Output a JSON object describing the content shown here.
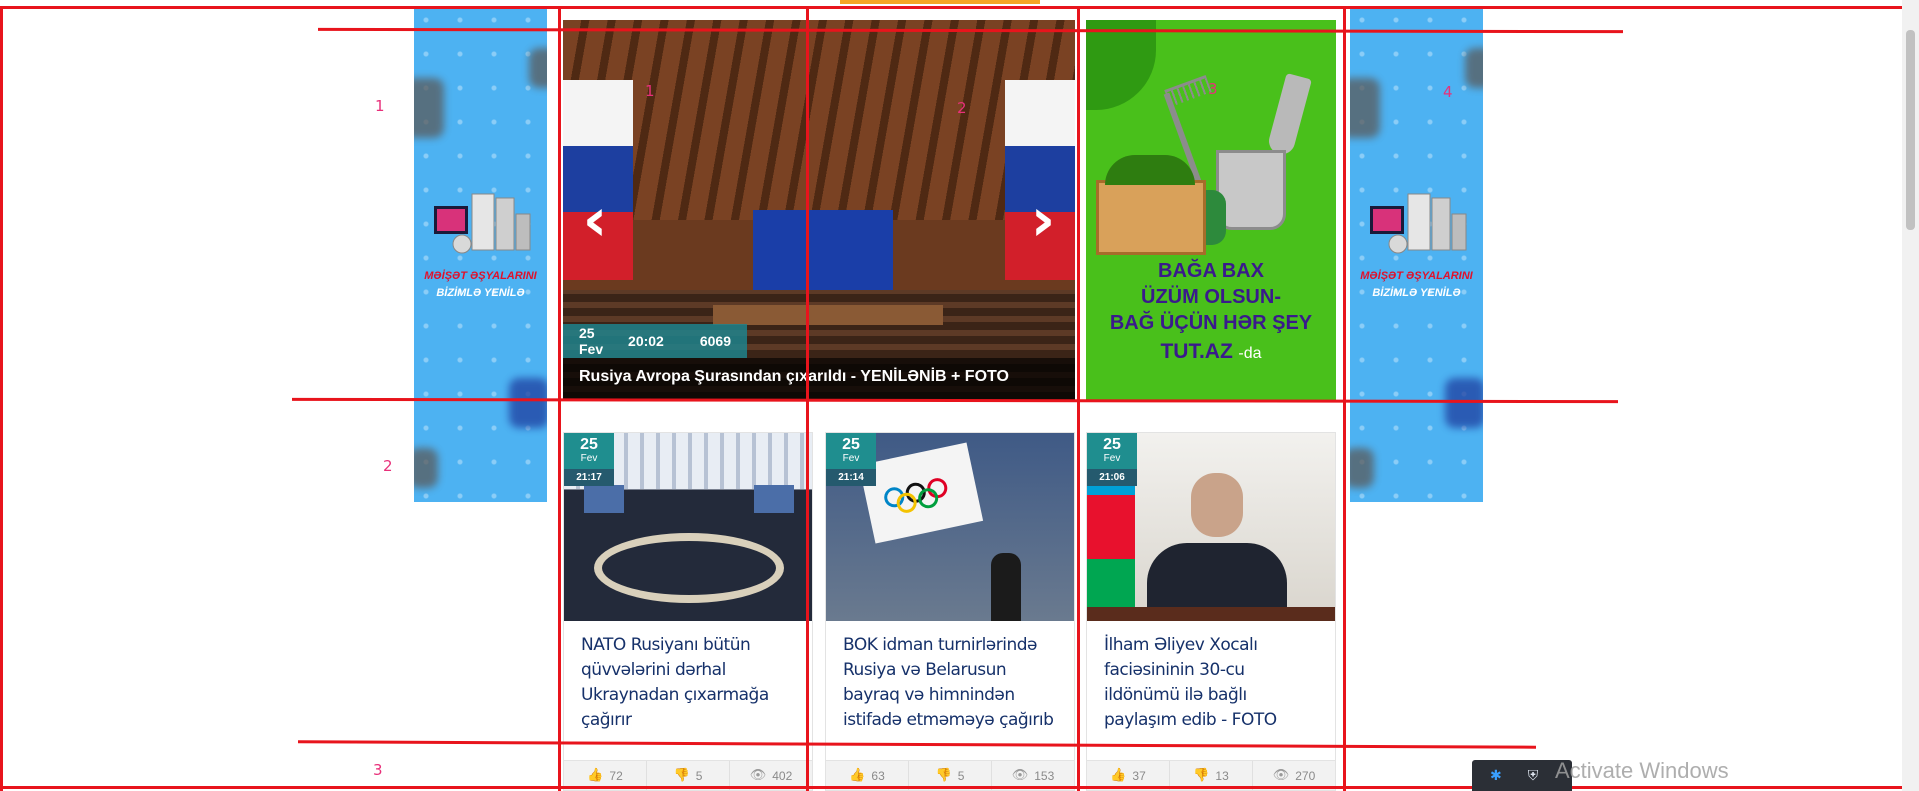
{
  "side_banner": {
    "line1": "MƏİŞƏT ƏŞYALARINI",
    "line2": "BİZİMLƏ YENİLƏ"
  },
  "slider": {
    "prev_label": "‹",
    "next_label": "›",
    "date": "25 Fev",
    "time": "20:02",
    "views": "6069",
    "caption": "Rusiya Avropa Şurasından çıxarıldı - YENİLƏNİB + FOTO"
  },
  "garden_ad": {
    "line1": "BAĞA BAX",
    "line2": "ÜZÜM OLSUN-",
    "line3": "BAĞ ÜÇÜN HƏR ŞEY",
    "brand": "TUT.AZ",
    "suffix": "-da"
  },
  "cards": [
    {
      "day": "25",
      "month": "Fev",
      "time": "21:17",
      "title": "NATO Rusiyanı bütün qüvvələrini dərhal Ukraynadan çıxarmağa çağırır",
      "likes": "72",
      "dislikes": "5",
      "views": "402"
    },
    {
      "day": "25",
      "month": "Fev",
      "time": "21:14",
      "title": "BOK idman turnirlərində Rusiya və Belarusun bayraq və himnindən istifadə etməməyə çağırıb",
      "likes": "63",
      "dislikes": "5",
      "views": "153"
    },
    {
      "day": "25",
      "month": "Fev",
      "time": "21:06",
      "title": "İlham Əliyev Xocalı faciəsininin 30-cu ildönümü ilə bağlı paylaşım edib - FOTO",
      "likes": "37",
      "dislikes": "13",
      "views": "270"
    }
  ],
  "annotations": {
    "row_labels": [
      "1",
      "2",
      "3"
    ],
    "column_labels": [
      "1",
      "2",
      "3",
      "4"
    ],
    "line_color": "#e8141c",
    "label_color": "#e8307a"
  },
  "icons": {
    "like": "thumbs-up-icon",
    "dislike": "thumbs-down-icon",
    "views": "eye-icon"
  },
  "watermark": "Activate Windows",
  "colors": {
    "accent_teal": "#1f8e8f",
    "title_blue": "#16316a",
    "ad_green": "#49c01b",
    "banner_blue": "#4db2f2"
  }
}
